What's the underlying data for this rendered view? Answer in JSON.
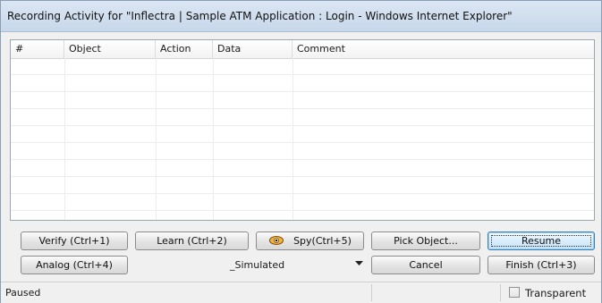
{
  "window": {
    "title": "Recording Activity for \"Inflectra | Sample ATM Application : Login - Windows Internet Explorer\""
  },
  "grid": {
    "columns": [
      "#",
      "Object",
      "Action",
      "Data",
      "Comment"
    ],
    "rows": []
  },
  "buttons": {
    "verify": "Verify (Ctrl+1)",
    "learn": "Learn (Ctrl+2)",
    "spy": "Spy(Ctrl+5)",
    "pick_object": "Pick Object...",
    "resume": "Resume",
    "analog": "Analog (Ctrl+4)",
    "cancel": "Cancel",
    "finish": "Finish (Ctrl+3)"
  },
  "play_mode": {
    "selected": "_Simulated"
  },
  "status": {
    "text": "Paused",
    "transparent_label": "Transparent",
    "transparent_checked": false
  },
  "icons": {
    "spy": "eye-icon",
    "dropdown": "chevron-down-icon"
  },
  "colors": {
    "titlebar": "#c7d7ea",
    "default_button_border": "#3c7fb1"
  }
}
